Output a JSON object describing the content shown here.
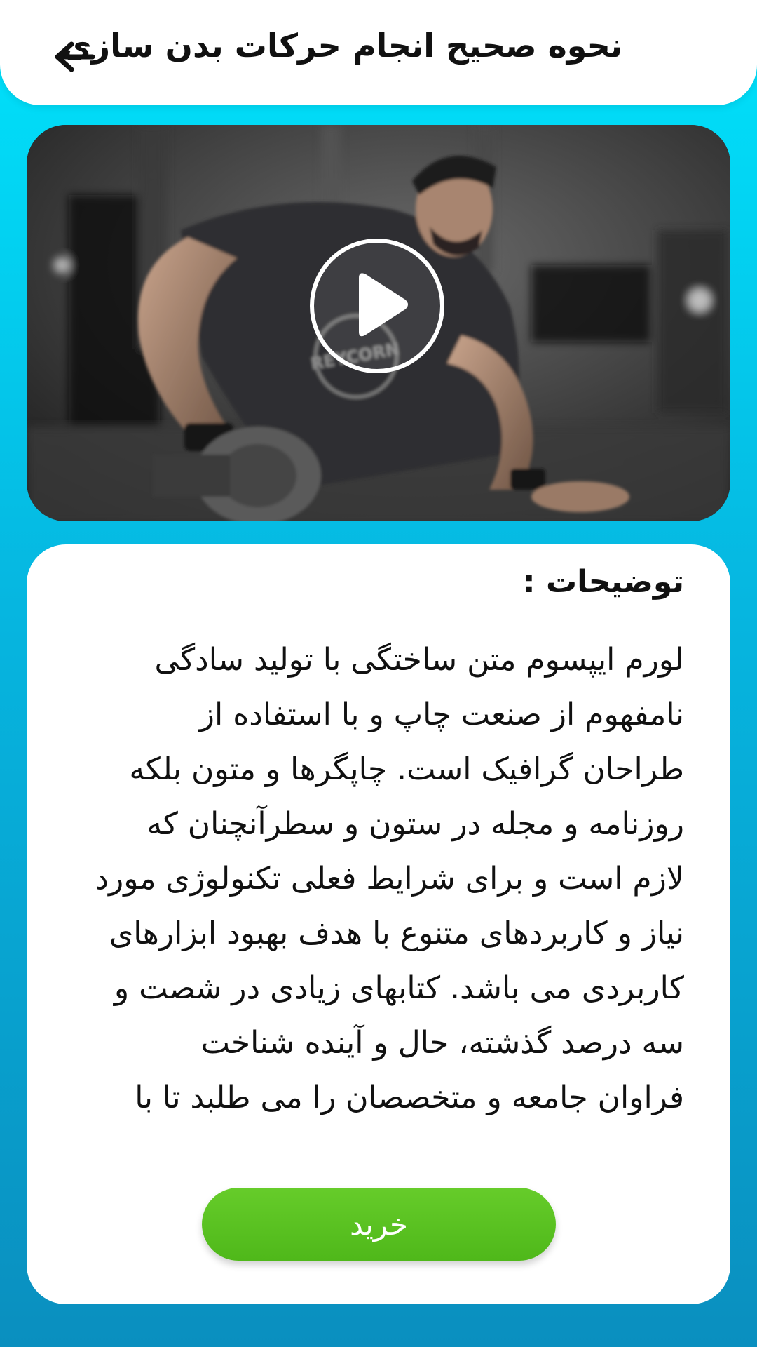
{
  "header": {
    "title": "نحوه صحیح انجام حرکات بدن سازی",
    "back_icon": "arrow-left-icon"
  },
  "video": {
    "play_icon": "play-icon",
    "shirt_text": "REYCORN"
  },
  "description": {
    "heading": "توضیحات :",
    "lines": [
      "لورم ایپسوم متن ساختگی با تولید سادگی",
      "نامفهوم از صنعت چاپ و با استفاده از",
      "طراحان گرافیک است. چاپگرها و متون بلکه",
      "روزنامه و مجله در ستون و سطرآنچنان که",
      "لازم است و برای شرایط فعلی تکنولوژی مورد",
      "نیاز و کاربردهای متنوع با هدف بهبود ابزارهای",
      "کاربردی می باشد. کتابهای زیادی در شصت و",
      "سه درصد گذشته، حال و آینده شناخت",
      "فراوان جامعه و متخصصان را می طلبد تا با"
    ]
  },
  "buy_button": {
    "label": "خرید"
  },
  "colors": {
    "background_top": "#00e3fc",
    "background_bottom": "#0a8fbf",
    "buy_button": "#5abf20",
    "card": "#ffffff",
    "text": "#111111"
  }
}
